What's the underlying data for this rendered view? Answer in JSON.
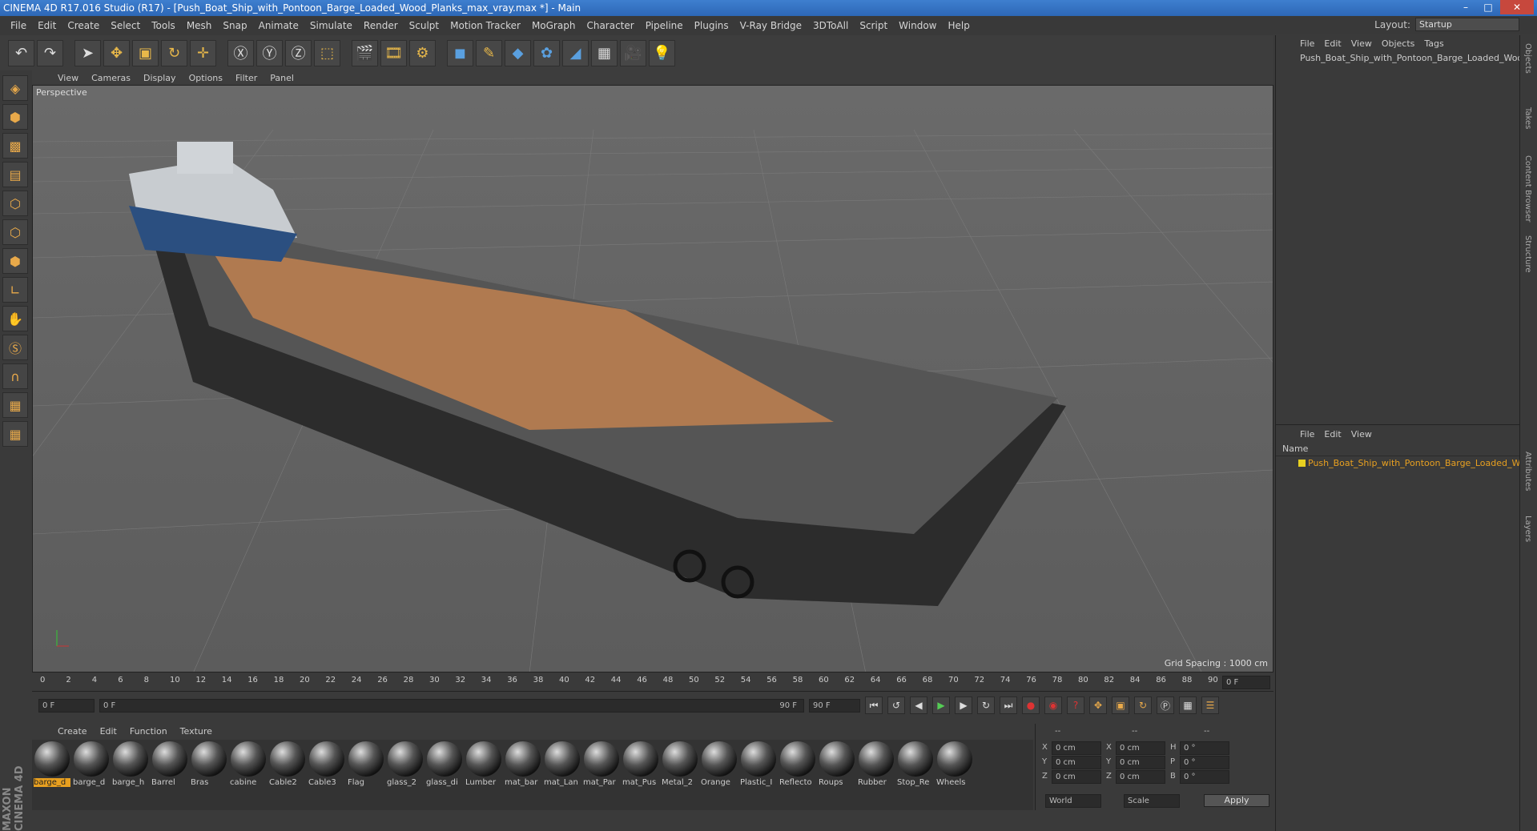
{
  "window": {
    "title": "CINEMA 4D R17.016 Studio (R17) - [Push_Boat_Ship_with_Pontoon_Barge_Loaded_Wood_Planks_max_vray.max *] - Main"
  },
  "menu": [
    "File",
    "Edit",
    "Create",
    "Select",
    "Tools",
    "Mesh",
    "Snap",
    "Animate",
    "Simulate",
    "Render",
    "Sculpt",
    "Motion Tracker",
    "MoGraph",
    "Character",
    "Pipeline",
    "Plugins",
    "V-Ray Bridge",
    "3DToAll",
    "Script",
    "Window",
    "Help"
  ],
  "layout": {
    "label": "Layout:",
    "value": "Startup"
  },
  "viewport": {
    "menu": [
      "View",
      "Cameras",
      "Display",
      "Options",
      "Filter",
      "Panel"
    ],
    "label": "Perspective",
    "grid_spacing": "Grid Spacing : 1000 cm"
  },
  "timeline": {
    "ticks": [
      "0",
      "2",
      "4",
      "6",
      "8",
      "10",
      "12",
      "14",
      "16",
      "18",
      "20",
      "22",
      "24",
      "26",
      "28",
      "30",
      "32",
      "34",
      "36",
      "38",
      "40",
      "42",
      "44",
      "46",
      "48",
      "50",
      "52",
      "54",
      "56",
      "58",
      "60",
      "62",
      "64",
      "66",
      "68",
      "70",
      "72",
      "74",
      "76",
      "78",
      "80",
      "82",
      "84",
      "86",
      "88",
      "90"
    ],
    "current": "0 F"
  },
  "playback": {
    "start": "0 F",
    "range_start": "0 F",
    "range_end": "90 F",
    "end": "90 F"
  },
  "materials": {
    "menu": [
      "Create",
      "Edit",
      "Function",
      "Texture"
    ],
    "items": [
      "barge_d",
      "barge_d",
      "barge_h",
      "Barrel",
      "Bras",
      "cabine",
      "Cable2",
      "Cable3",
      "Flag",
      "glass_2",
      "glass_di",
      "Lumber",
      "mat_bar",
      "mat_Lan",
      "mat_Par",
      "mat_Pus",
      "Metal_2",
      "Orange",
      "Plastic_I",
      "Reflecto",
      "Roups",
      "Rubber",
      "Stop_Re",
      "Wheels"
    ]
  },
  "coords": {
    "headers": [
      "--",
      "--",
      "--"
    ],
    "rows": [
      {
        "a": "X",
        "av": "0 cm",
        "b": "X",
        "bv": "0 cm",
        "c": "H",
        "cv": "0 °"
      },
      {
        "a": "Y",
        "av": "0 cm",
        "b": "Y",
        "bv": "0 cm",
        "c": "P",
        "cv": "0 °"
      },
      {
        "a": "Z",
        "av": "0 cm",
        "b": "Z",
        "bv": "0 cm",
        "c": "B",
        "cv": "0 °"
      }
    ],
    "world": "World",
    "scale": "Scale",
    "apply": "Apply"
  },
  "objects_panel": {
    "menu": [
      "File",
      "Edit",
      "View",
      "Objects",
      "Tags"
    ],
    "item": "Push_Boat_Ship_with_Pontoon_Barge_Loaded_Woo"
  },
  "layers_panel": {
    "menu": [
      "File",
      "Edit",
      "View"
    ],
    "header": "Name",
    "item": "Push_Boat_Ship_with_Pontoon_Barge_Loaded_Wo"
  },
  "side_tabs": [
    "Objects",
    "Takes",
    "Content Browser",
    "Structure",
    "Attributes",
    "Layers"
  ],
  "brand": "MAXON CINEMA 4D"
}
